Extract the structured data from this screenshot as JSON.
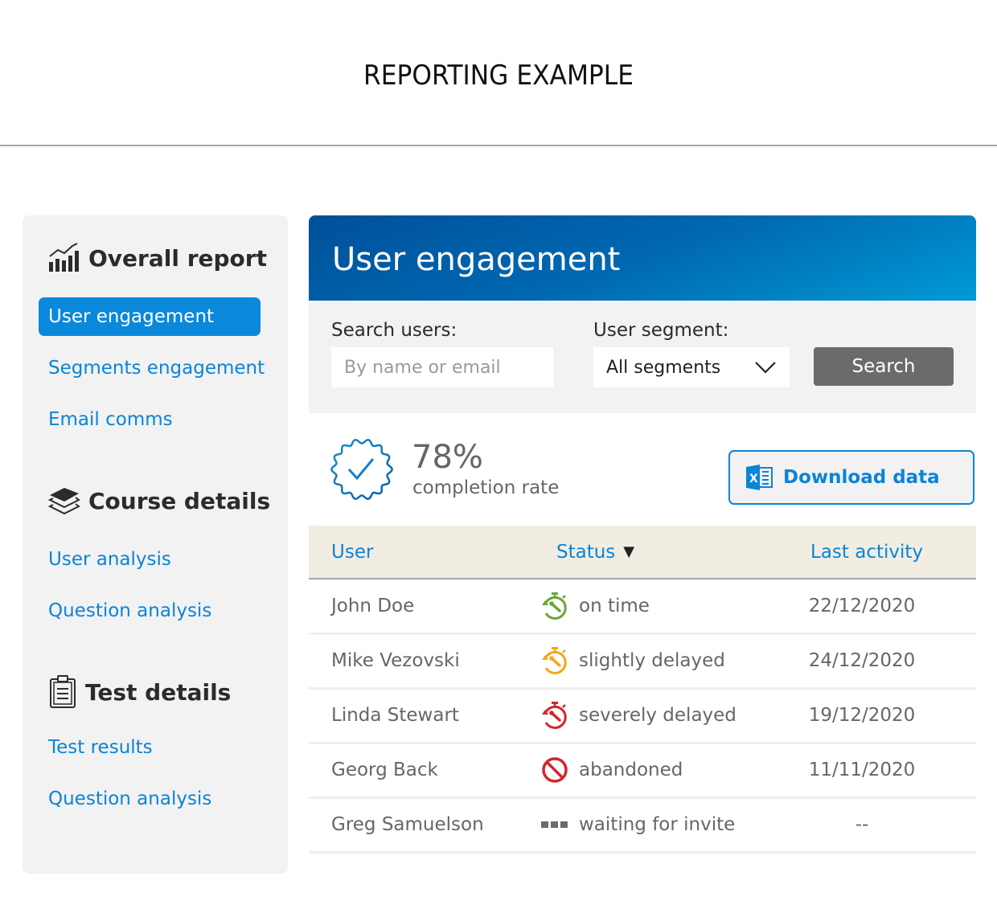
{
  "page": {
    "title": "REPORTING EXAMPLE"
  },
  "sidebar": {
    "sections": [
      {
        "title": "Overall report",
        "icon": "bar-chart-trend-icon",
        "items": [
          {
            "label": "User engagement",
            "active": true
          },
          {
            "label": "Segments engagement",
            "active": false
          },
          {
            "label": "Email comms",
            "active": false
          }
        ]
      },
      {
        "title": "Course details",
        "icon": "layers-icon",
        "items": [
          {
            "label": "User analysis",
            "active": false
          },
          {
            "label": "Question analysis",
            "active": false
          }
        ]
      },
      {
        "title": "Test details",
        "icon": "clipboard-icon",
        "items": [
          {
            "label": "Test results",
            "active": false
          },
          {
            "label": "Question analysis",
            "active": false
          }
        ]
      }
    ]
  },
  "main": {
    "title": "User engagement",
    "filters": {
      "search_label": "Search users:",
      "search_placeholder": "By name or email",
      "search_value": "",
      "segment_label": "User segment:",
      "segment_selected": "All segments",
      "search_button": "Search"
    },
    "summary": {
      "completion_value": "78%",
      "completion_label": "completion rate",
      "download_label": "Download data",
      "download_icon": "excel-icon"
    },
    "table": {
      "columns": [
        "User",
        "Status",
        "Last activity"
      ],
      "sort_column": "Status",
      "sort_direction": "descending",
      "rows": [
        {
          "user": "John Doe",
          "status": "on time",
          "status_icon": "stopwatch-icon",
          "status_color": "#6aa539",
          "last_activity": "22/12/2020"
        },
        {
          "user": "Mike Vezovski",
          "status": "slightly delayed",
          "status_icon": "stopwatch-icon",
          "status_color": "#f2a71b",
          "last_activity": "24/12/2020"
        },
        {
          "user": "Linda Stewart",
          "status": "severely delayed",
          "status_icon": "stopwatch-icon",
          "status_color": "#d2262b",
          "last_activity": "19/12/2020"
        },
        {
          "user": "Georg Back",
          "status": "abandoned",
          "status_icon": "prohibited-icon",
          "status_color": "#d2262b",
          "last_activity": "11/11/2020"
        },
        {
          "user": "Greg Samuelson",
          "status": "waiting for invite",
          "status_icon": "dots-icon",
          "status_color": "#6b6b6b",
          "last_activity": "--"
        }
      ]
    }
  },
  "colors": {
    "accent": "#0a84d6",
    "header_gradient_start": "#00509a",
    "header_gradient_end": "#009ad6",
    "table_header_bg": "#f1ede2",
    "sidebar_bg": "#f2f2f2",
    "search_button_bg": "#6b6b6b"
  }
}
